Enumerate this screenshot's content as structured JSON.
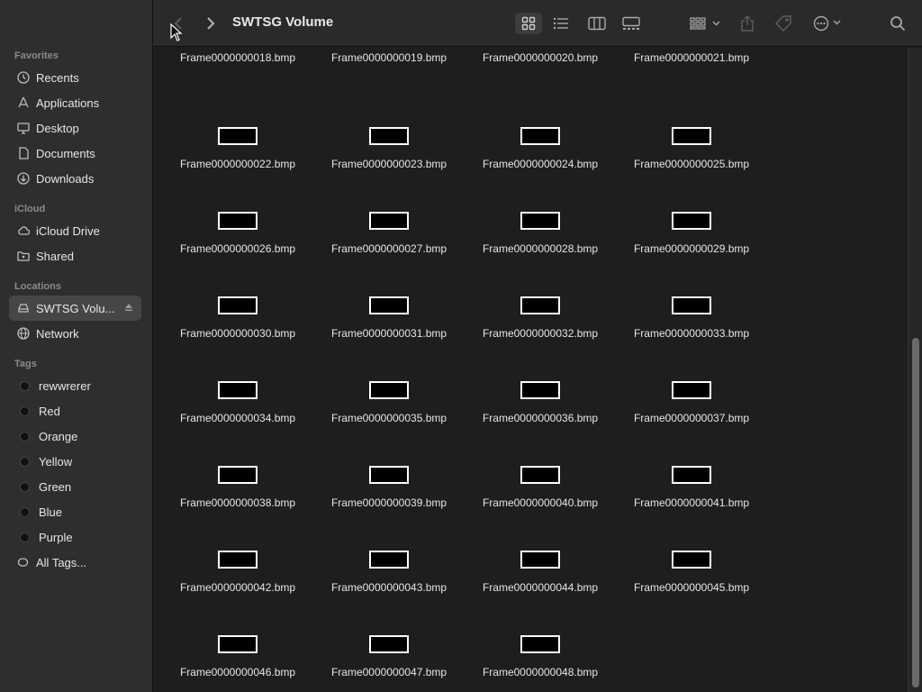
{
  "window": {
    "title": "SWTSG Volume"
  },
  "sidebar": {
    "favorites_title": "Favorites",
    "favorites": [
      {
        "label": "Recents",
        "icon": "clock-icon"
      },
      {
        "label": "Applications",
        "icon": "applications-icon"
      },
      {
        "label": "Desktop",
        "icon": "desktop-icon"
      },
      {
        "label": "Documents",
        "icon": "document-icon"
      },
      {
        "label": "Downloads",
        "icon": "download-icon"
      }
    ],
    "icloud_title": "iCloud",
    "icloud": [
      {
        "label": "iCloud Drive",
        "icon": "cloud-icon"
      },
      {
        "label": "Shared",
        "icon": "shared-folder-icon"
      }
    ],
    "locations_title": "Locations",
    "locations": [
      {
        "label": "SWTSG Volu...",
        "icon": "drive-icon",
        "selected": true
      },
      {
        "label": "Network",
        "icon": "globe-icon"
      }
    ],
    "tags_title": "Tags",
    "tags": [
      {
        "label": "rewwrerer"
      },
      {
        "label": "Red"
      },
      {
        "label": "Orange"
      },
      {
        "label": "Yellow"
      },
      {
        "label": "Green"
      },
      {
        "label": "Blue"
      },
      {
        "label": "Purple"
      }
    ],
    "all_tags": "All Tags..."
  },
  "files": [
    "Frame0000000018.bmp",
    "Frame0000000019.bmp",
    "Frame0000000020.bmp",
    "Frame0000000021.bmp",
    "Frame0000000022.bmp",
    "Frame0000000023.bmp",
    "Frame0000000024.bmp",
    "Frame0000000025.bmp",
    "Frame0000000026.bmp",
    "Frame0000000027.bmp",
    "Frame0000000028.bmp",
    "Frame0000000029.bmp",
    "Frame0000000030.bmp",
    "Frame0000000031.bmp",
    "Frame0000000032.bmp",
    "Frame0000000033.bmp",
    "Frame0000000034.bmp",
    "Frame0000000035.bmp",
    "Frame0000000036.bmp",
    "Frame0000000037.bmp",
    "Frame0000000038.bmp",
    "Frame0000000039.bmp",
    "Frame0000000040.bmp",
    "Frame0000000041.bmp",
    "Frame0000000042.bmp",
    "Frame0000000043.bmp",
    "Frame0000000044.bmp",
    "Frame0000000045.bmp",
    "Frame0000000046.bmp",
    "Frame0000000047.bmp",
    "Frame0000000048.bmp"
  ]
}
